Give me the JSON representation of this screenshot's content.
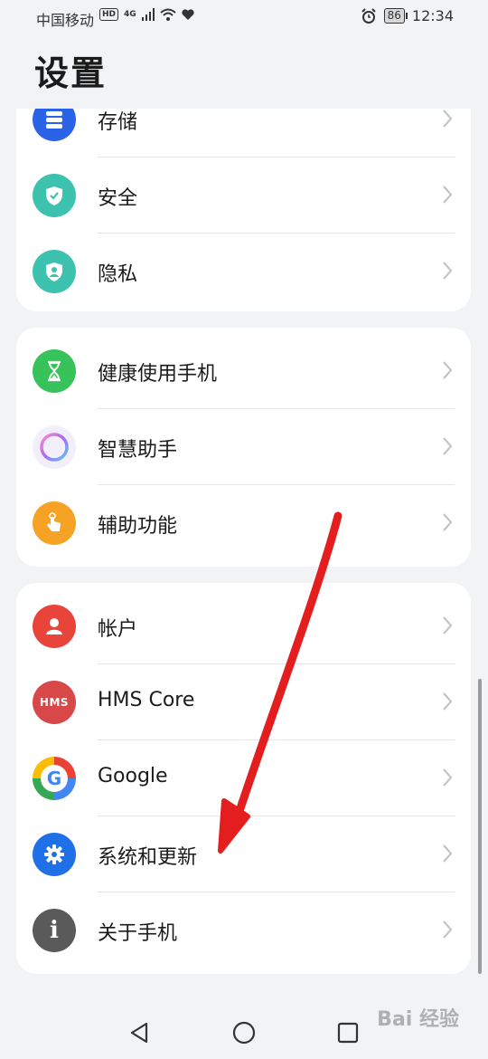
{
  "status_bar": {
    "carrier": "中国移动",
    "hd": "HD",
    "network": "4G",
    "battery": "86",
    "time": "12:34"
  },
  "page": {
    "title": "设置"
  },
  "cards": [
    {
      "items": [
        {
          "label": "存储",
          "icon": "storage-icon",
          "color": "#2a63e8"
        },
        {
          "label": "安全",
          "icon": "security-shield-icon",
          "color": "#3cc2ae"
        },
        {
          "label": "隐私",
          "icon": "privacy-icon",
          "color": "#3cc2ae"
        }
      ]
    },
    {
      "items": [
        {
          "label": "健康使用手机",
          "icon": "hourglass-icon",
          "color": "#38c25a"
        },
        {
          "label": "智慧助手",
          "icon": "assistant-ring-icon",
          "color": "#b47cf0"
        },
        {
          "label": "辅助功能",
          "icon": "accessibility-hand-icon",
          "color": "#f5a225"
        }
      ]
    },
    {
      "items": [
        {
          "label": "帐户",
          "icon": "account-icon",
          "color": "#e8443a"
        },
        {
          "label": "HMS Core",
          "icon": "hms-icon",
          "icon_text": "HMS",
          "color": "#d94848"
        },
        {
          "label": "Google",
          "icon": "google-icon",
          "icon_text": "G",
          "color": "#4285f4"
        },
        {
          "label": "系统和更新",
          "icon": "gear-icon",
          "color": "#1f6fe8"
        },
        {
          "label": "关于手机",
          "icon": "info-icon",
          "icon_text": "i",
          "color": "#5a5a5a"
        }
      ]
    }
  ],
  "watermark": "Bai 经验"
}
